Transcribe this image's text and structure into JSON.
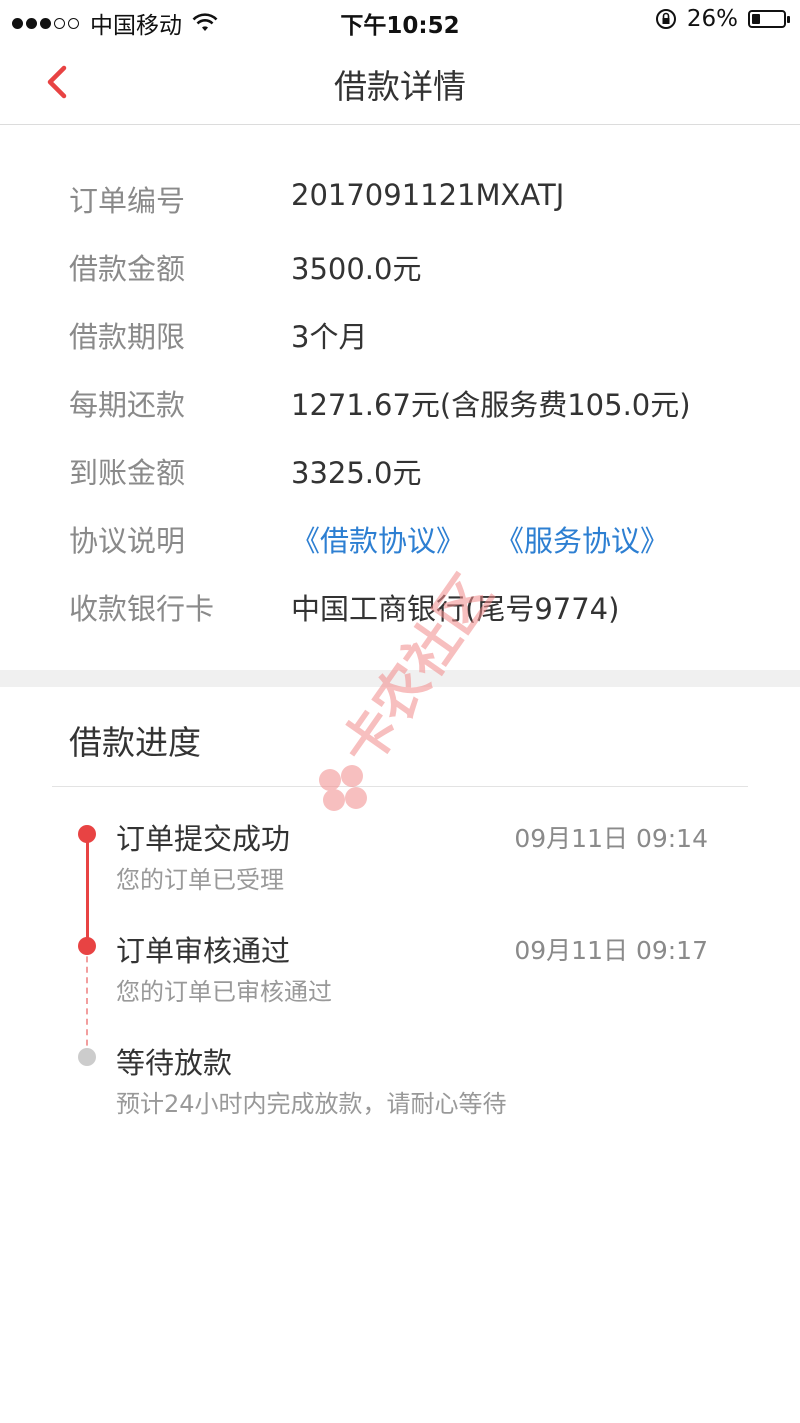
{
  "status_bar": {
    "carrier": "中国移动",
    "time": "下午10:52",
    "battery": "26%",
    "battery_level": 0.26,
    "signal_dots_filled": 3,
    "signal_dots_total": 5
  },
  "nav": {
    "title": "借款详情",
    "back_icon": "chevron-left-icon"
  },
  "details": [
    {
      "label": "订单编号",
      "value": "2017091121MXATJ"
    },
    {
      "label": "借款金额",
      "value": "3500.0元"
    },
    {
      "label": "借款期限",
      "value": "3个月"
    },
    {
      "label": "每期还款",
      "value": "1271.67元(含服务费105.0元)"
    },
    {
      "label": "到账金额",
      "value": "3325.0元"
    },
    {
      "label": "协议说明",
      "links": [
        "《借款协议》",
        "《服务协议》"
      ]
    },
    {
      "label": "收款银行卡",
      "value": "中国工商银行(尾号9774)"
    }
  ],
  "progress": {
    "title": "借款进度",
    "steps": [
      {
        "title": "订单提交成功",
        "subtitle": "您的订单已受理",
        "time": "09月11日 09:14",
        "status": "done"
      },
      {
        "title": "订单审核通过",
        "subtitle": "您的订单已审核通过",
        "time": "09月11日 09:17",
        "status": "done"
      },
      {
        "title": "等待放款",
        "subtitle": "预计24小时内完成放款，请耐心等待",
        "time": "",
        "status": "pending"
      }
    ]
  },
  "watermark": {
    "text": "卡农社区"
  },
  "colors": {
    "accent": "#e84343",
    "link": "#2d7fd2",
    "label": "#8a8a8a",
    "text": "#333333",
    "pending": "#cccccc",
    "watermark": "#f4a0a0"
  }
}
